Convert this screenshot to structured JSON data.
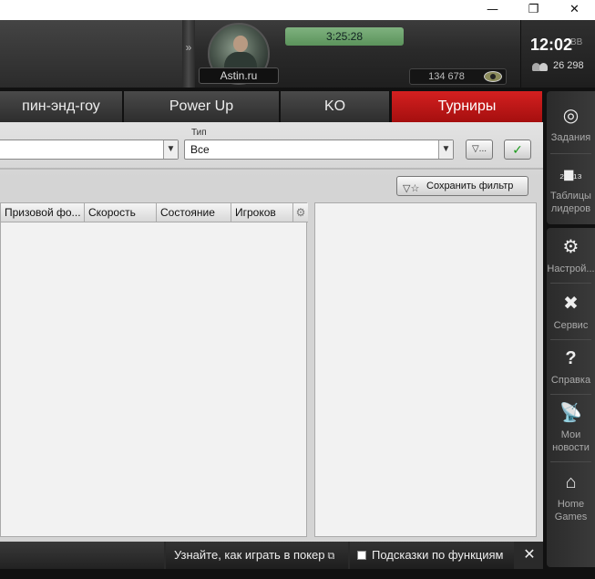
{
  "window": {
    "minimize": "—",
    "maximize": "❐",
    "close": "✕"
  },
  "header": {
    "username": "Astin.ru",
    "timer": "3:25:28",
    "balance": "134 678",
    "clock": "12:02",
    "clock_zone": "BB",
    "players_online": "26 298"
  },
  "tabs": [
    {
      "label": "пин-энд-гоу",
      "active": false
    },
    {
      "label": "Power Up",
      "active": false
    },
    {
      "label": "KO",
      "active": false
    },
    {
      "label": "Турниры",
      "active": true
    }
  ],
  "filters": {
    "type_label": "Тип",
    "type_value": "Все",
    "left_select_value": "",
    "save_filter": "Сохранить фильтр"
  },
  "table": {
    "columns": [
      "Призовой фо...",
      "Скорость",
      "Состояние",
      "Игроков"
    ]
  },
  "footer": {
    "learn_link": "Узнайте, как играть в покер",
    "hints": "Подсказки по функциям",
    "close": "✕"
  },
  "sidebar": {
    "items": [
      {
        "label": "Задания",
        "icon": "target-icon"
      },
      {
        "label": "Таблицы лидеров",
        "icon": "podium-icon"
      },
      {
        "label": "Настрой...",
        "icon": "gear-icon"
      },
      {
        "label": "Сервис",
        "icon": "tools-icon"
      },
      {
        "label": "Справка",
        "icon": "question-icon"
      },
      {
        "label": "Мои новости",
        "icon": "antenna-icon"
      },
      {
        "label": "Home Games",
        "icon": "home-icon"
      }
    ]
  },
  "colors": {
    "active_tab": "#c41616",
    "timer_bg": "#6fa56f",
    "check_green": "#1a9a1a"
  }
}
